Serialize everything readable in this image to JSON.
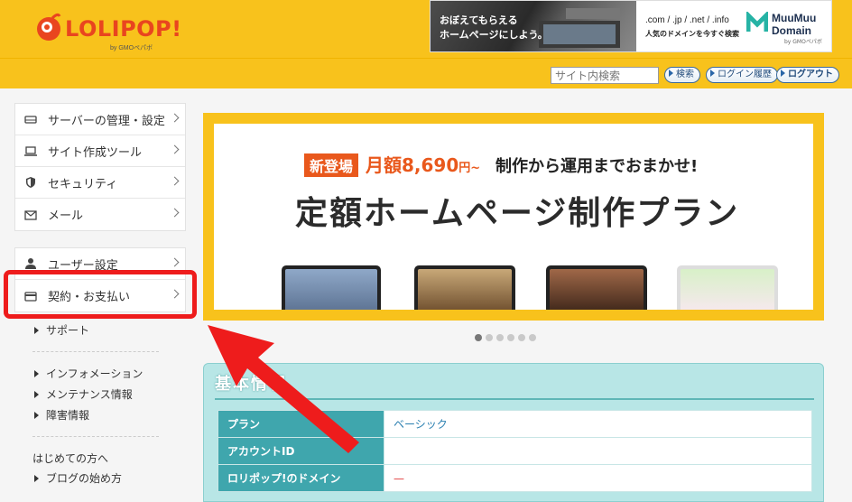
{
  "header": {
    "logo_text": "LOLIPOP!",
    "logo_sub": "by GMOペパボ",
    "ad": {
      "photo_line1": "おぼえてもらえる",
      "photo_line2": "ホームページにしよう。",
      "domains": ".com / .jp / .net / .info",
      "tagline": "人気のドメインを今すぐ検索",
      "brand_line1": "MuuMuu",
      "brand_line2": "Domain",
      "brand_sub": "by GMOペパボ"
    }
  },
  "subbar": {
    "search_placeholder": "サイト内検索",
    "search_button": "検索",
    "login_history": "ログイン履歴",
    "logout": "ログアウト"
  },
  "sidebar": {
    "group1": [
      {
        "label": "サーバーの管理・設定",
        "icon": "server-icon"
      },
      {
        "label": "サイト作成ツール",
        "icon": "laptop-icon"
      },
      {
        "label": "セキュリティ",
        "icon": "shield-icon"
      },
      {
        "label": "メール",
        "icon": "mail-icon"
      }
    ],
    "group2": [
      {
        "label": "ユーザー設定",
        "icon": "user-icon"
      },
      {
        "label": "契約・お支払い",
        "icon": "credit-card-icon"
      }
    ],
    "support": "サポート",
    "info_links": [
      "インフォメーション",
      "メンテナンス情報",
      "障害情報"
    ],
    "guide_links": [
      "はじめての方へ",
      "ブログの始め方"
    ]
  },
  "hero": {
    "badge": "新登場",
    "price_prefix": "月額",
    "price": "8,690",
    "price_unit": "円~",
    "tagline": "制作から運用までおまかせ!",
    "title": "定額ホームページ制作プラン"
  },
  "carousel": {
    "count": 6,
    "active": 0
  },
  "info": {
    "title": "基本情報",
    "rows": [
      {
        "label": "プラン",
        "value": "ベーシック"
      },
      {
        "label": "アカウントID",
        "value": ""
      },
      {
        "label": "ロリポップ!のドメイン",
        "value": "—"
      }
    ]
  },
  "colors": {
    "header_yellow": "#f8c21c",
    "brand_red": "#e9451f",
    "highlight_red": "#ee1c1c",
    "teal": "#3fa6ad"
  }
}
